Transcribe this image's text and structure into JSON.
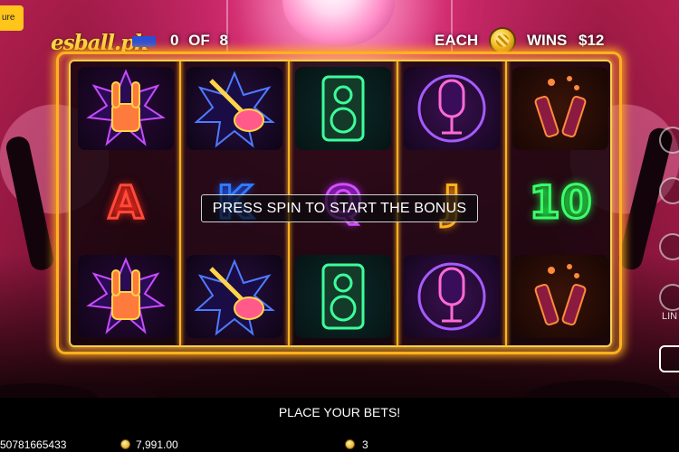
{
  "header": {
    "feature_tab": "ure",
    "brand": "esball.ph",
    "bonus_count": "0 OF 8",
    "each_label": "EACH",
    "coin_icon": "gold-coin-icon",
    "wins_label": "WINS",
    "wins_value": "$12"
  },
  "reels": [
    {
      "symbols": [
        "rock-hand-icon",
        "A",
        "rock-hand-icon"
      ]
    },
    {
      "symbols": [
        "electric-guitar-icon",
        "K",
        "electric-guitar-icon"
      ]
    },
    {
      "symbols": [
        "speaker-icon",
        "Q",
        "speaker-icon"
      ]
    },
    {
      "symbols": [
        "microphone-icon",
        "J",
        "microphone-icon"
      ]
    },
    {
      "symbols": [
        "beer-bottles-icon",
        "10",
        "beer-bottles-icon"
      ]
    }
  ],
  "message": "PRESS SPIN TO START THE BONUS",
  "side": {
    "label": "LIN"
  },
  "status": "PLACE YOUR BETS!",
  "footer": {
    "session_id": "50781665433",
    "balance": "7,991.00",
    "bet": "3"
  },
  "colors": {
    "frame": "#ffb21f",
    "letter_A": "#ff4a3a",
    "letter_K": "#2f7bff",
    "letter_Q": "#d44cff",
    "letter_J": "#ffb21f",
    "letter_10": "#3cff6a"
  }
}
